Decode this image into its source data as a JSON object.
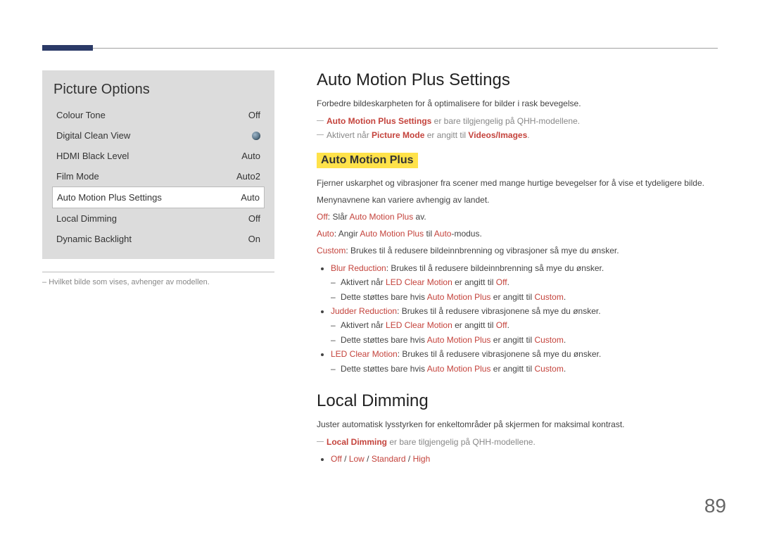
{
  "page_number": "89",
  "menu": {
    "title": "Picture Options",
    "rows": [
      {
        "label": "Colour Tone",
        "value": "Off",
        "toggle": false,
        "selected": false
      },
      {
        "label": "Digital Clean View",
        "value": "",
        "toggle": true,
        "selected": false
      },
      {
        "label": "HDMI Black Level",
        "value": "Auto",
        "toggle": false,
        "selected": false
      },
      {
        "label": "Film Mode",
        "value": "Auto2",
        "toggle": false,
        "selected": false
      },
      {
        "label": "Auto Motion Plus Settings",
        "value": "Auto",
        "toggle": false,
        "selected": true
      },
      {
        "label": "Local Dimming",
        "value": "Off",
        "toggle": false,
        "selected": false
      },
      {
        "label": "Dynamic Backlight",
        "value": "On",
        "toggle": false,
        "selected": false
      }
    ]
  },
  "footnote_prefix": "– ",
  "footnote": "Hvilket bilde som vises, avhenger av modellen.",
  "amp": {
    "heading": "Auto Motion Plus Settings",
    "intro": "Forbedre bildeskarpheten for å optimalisere for bilder i rask bevegelse.",
    "note1_bold": "Auto Motion Plus Settings",
    "note1_rest": " er bare tilgjengelig på QHH-modellene.",
    "note2": {
      "pre": "Aktivert når ",
      "mode_label": "Picture Mode",
      "mid": " er angitt til ",
      "mode_value": "Videos/Images",
      "post": "."
    },
    "sub_heading": "Auto Motion Plus",
    "sub_desc1": "Fjerner uskarphet og vibrasjoner fra scener med mange hurtige bevegelser for å vise et tydeligere bilde.",
    "sub_desc2": "Menynavnene kan variere avhengig av landet.",
    "off": {
      "label": "Off",
      "sep": ": Slår ",
      "name": "Auto Motion Plus",
      "tail": " av."
    },
    "auto": {
      "label": "Auto",
      "sep": ": Angir ",
      "name": "Auto Motion Plus",
      "mid": " til ",
      "val": "Auto",
      "tail": "-modus."
    },
    "custom": {
      "label": "Custom",
      "sep": ": Brukes til å redusere bildeinnbrenning og vibrasjoner så mye du ønsker."
    },
    "blur": {
      "label": "Blur Reduction",
      "desc": ": Brukes til å redusere bildeinnbrenning så mye du ønsker.",
      "d1_pre": "Aktivert når ",
      "d1_name": "LED Clear Motion",
      "d1_mid": " er angitt til ",
      "d1_val": "Off",
      "d1_post": ".",
      "d2_pre": "Dette støttes bare hvis ",
      "d2_name": "Auto Motion Plus",
      "d2_mid": " er angitt til ",
      "d2_val": "Custom",
      "d2_post": "."
    },
    "judder": {
      "label": "Judder Reduction",
      "desc": ": Brukes til å redusere vibrasjonene så mye du ønsker.",
      "d1_pre": "Aktivert når ",
      "d1_name": "LED Clear Motion",
      "d1_mid": " er angitt til ",
      "d1_val": "Off",
      "d1_post": ".",
      "d2_pre": "Dette støttes bare hvis ",
      "d2_name": "Auto Motion Plus",
      "d2_mid": " er angitt til ",
      "d2_val": "Custom",
      "d2_post": "."
    },
    "led": {
      "label": "LED Clear Motion",
      "desc": ": Brukes til å redusere vibrasjonene så mye du ønsker.",
      "d1_pre": "Dette støttes bare hvis ",
      "d1_name": "Auto Motion Plus",
      "d1_mid": " er angitt til ",
      "d1_val": "Custom",
      "d1_post": "."
    }
  },
  "ld": {
    "heading": "Local Dimming",
    "intro": "Juster automatisk lysstyrken for enkeltområder på skjermen for maksimal kontrast.",
    "note_bold": "Local Dimming",
    "note_rest": " er bare tilgjengelig på QHH-modellene.",
    "opts": {
      "off": "Off",
      "low": "Low",
      "std": "Standard",
      "high": "High",
      "sep": " / "
    }
  }
}
